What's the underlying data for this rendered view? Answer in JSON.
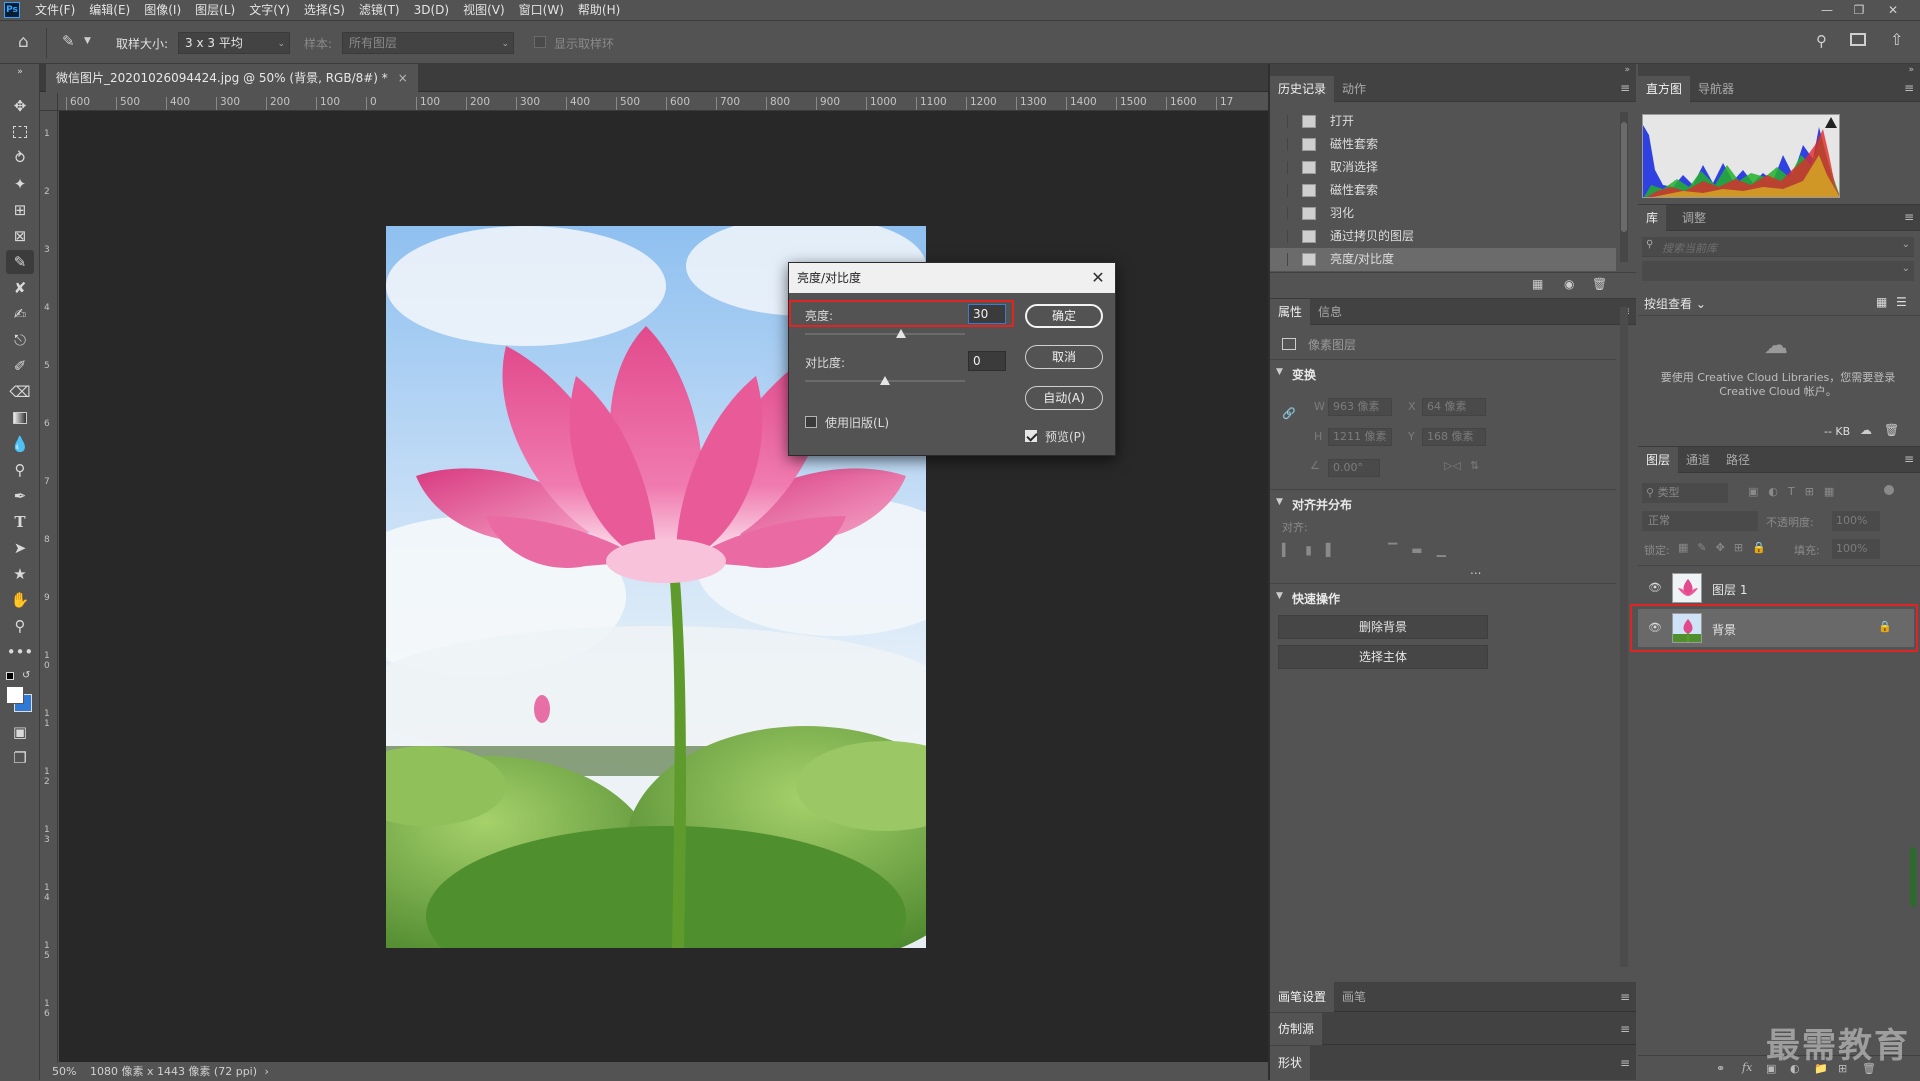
{
  "app": {
    "logo": "Ps"
  },
  "menu": [
    "文件(F)",
    "编辑(E)",
    "图像(I)",
    "图层(L)",
    "文字(Y)",
    "选择(S)",
    "滤镜(T)",
    "3D(D)",
    "视图(V)",
    "窗口(W)",
    "帮助(H)"
  ],
  "options": {
    "sample_size_label": "取样大小:",
    "sample_size_value": "3 x 3 平均",
    "sample_label": "样本:",
    "sample_value": "所有图层",
    "show_ring_label": "显示取样环"
  },
  "document": {
    "tab_title": "微信图片_20201026094424.jpg @ 50% (背景, RGB/8#) *",
    "status_zoom": "50%",
    "status_info": "1080 像素 x 1443 像素 (72 ppi)"
  },
  "ruler_h": [
    "600",
    "500",
    "400",
    "300",
    "200",
    "100",
    "0",
    "100",
    "200",
    "300",
    "400",
    "500",
    "600",
    "700",
    "800",
    "900",
    "1000",
    "1100",
    "1200",
    "1300",
    "1400",
    "1500",
    "1600",
    "17"
  ],
  "ruler_v": [
    "1",
    "2",
    "3",
    "4",
    "5",
    "6",
    "7",
    "8",
    "9",
    "10",
    "11",
    "12",
    "13",
    "14",
    "15",
    "16"
  ],
  "dialog": {
    "title": "亮度/对比度",
    "brightness_label": "亮度:",
    "brightness_value": "30",
    "brightness_fraction": 0.6,
    "contrast_label": "对比度:",
    "contrast_value": "0",
    "contrast_fraction": 0.5,
    "ok": "确定",
    "cancel": "取消",
    "auto": "自动(A)",
    "legacy_label": "使用旧版(L)",
    "legacy_checked": false,
    "preview_label": "预览(P)",
    "preview_checked": true
  },
  "history": {
    "tabs": [
      "历史记录",
      "动作"
    ],
    "items": [
      "打开",
      "磁性套索",
      "取消选择",
      "磁性套索",
      "羽化",
      "通过拷贝的图层",
      "亮度/对比度"
    ],
    "item_icons": [
      "document-icon",
      "lasso-icon",
      "document-icon",
      "lasso-icon",
      "document-icon",
      "document-icon",
      "document-icon"
    ]
  },
  "properties": {
    "tabs": [
      "属性",
      "信息"
    ],
    "pixel_layer": "像素图层",
    "transform_title": "变换",
    "w_label": "W",
    "w_value": "963 像素",
    "x_label": "X",
    "x_value": "64 像素",
    "h_label": "H",
    "h_value": "1211 像素",
    "y_label": "Y",
    "y_value": "168 像素",
    "angle_value": "0.00°",
    "align_title": "对齐并分布",
    "align_label": "对齐:",
    "more": "...",
    "quick_title": "快速操作",
    "remove_bg": "删除背景",
    "select_subject": "选择主体"
  },
  "bottom_panels": {
    "brush_tabs": [
      "画笔设置",
      "画笔"
    ],
    "clone_source": "仿制源",
    "shape": "形状"
  },
  "histogram": {
    "tabs": [
      "直方图",
      "导航器"
    ]
  },
  "library": {
    "tabs": [
      "库",
      "调整"
    ],
    "search_placeholder": "搜索当前库",
    "group_view": "按组查看",
    "cc_message": "要使用 Creative Cloud Libraries，您需要登录 Creative Cloud 帐户。",
    "kb": "-- KB"
  },
  "layers": {
    "tabs": [
      "图层",
      "通道",
      "路径"
    ],
    "filter_label": "类型",
    "blend_mode": "正常",
    "opacity_label": "不透明度:",
    "opacity_value": "100%",
    "lock_label": "锁定:",
    "fill_label": "填充:",
    "fill_value": "100%",
    "items": [
      {
        "name": "图层 1"
      },
      {
        "name": "背景"
      }
    ]
  },
  "watermark": "最需教育",
  "colors": {
    "accent": "#31a8ff",
    "highlight": "#e02424"
  }
}
